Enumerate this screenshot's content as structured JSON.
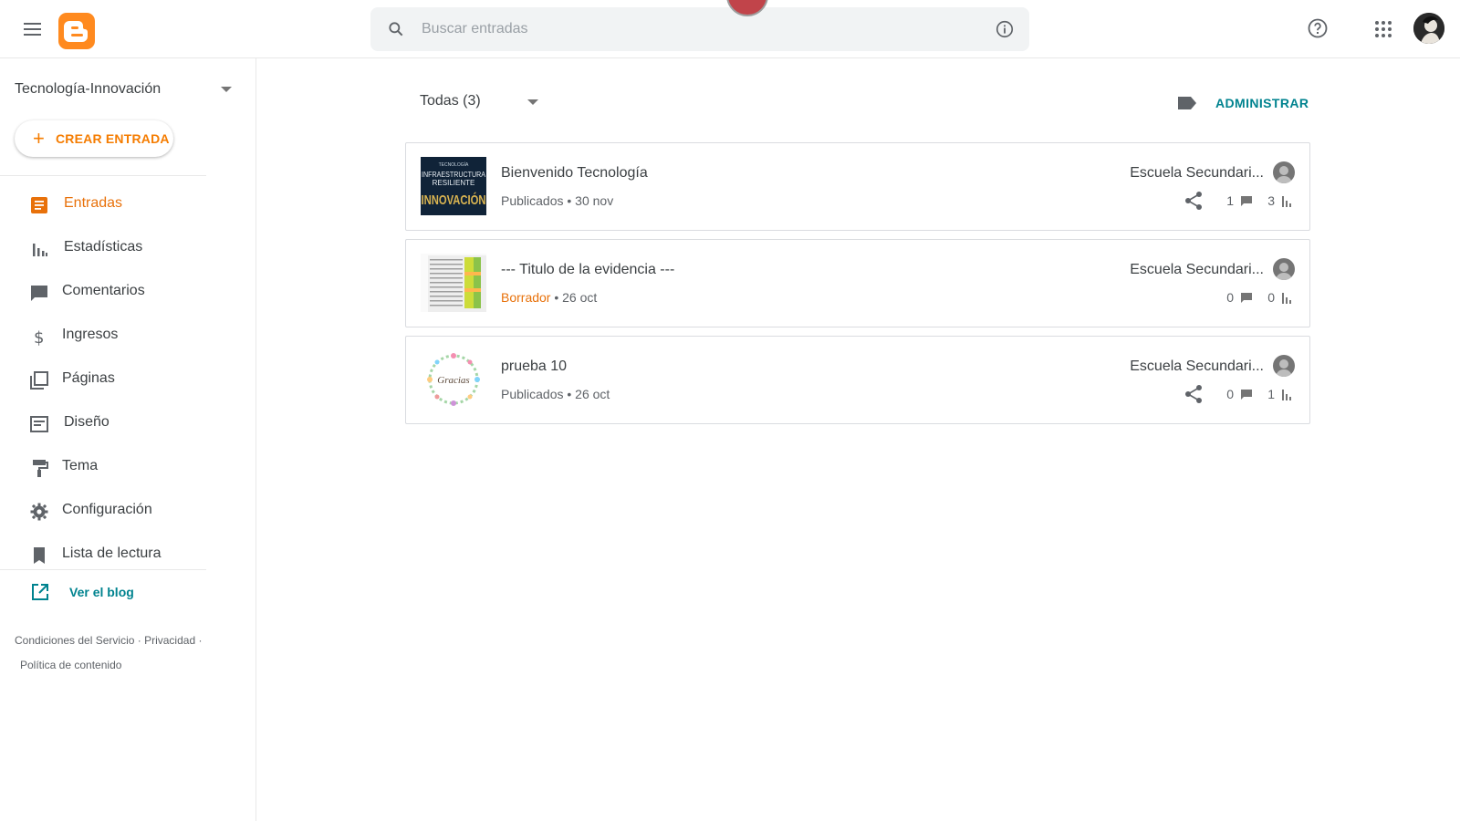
{
  "search": {
    "placeholder": "Buscar entradas"
  },
  "sidebar": {
    "blog_title": "Tecnología-Innovación",
    "create_label": "CREAR ENTRADA",
    "items": [
      {
        "label": "Entradas",
        "icon": "posts-icon"
      },
      {
        "label": "Estadísticas",
        "icon": "stats-icon"
      },
      {
        "label": "Comentarios",
        "icon": "comments-icon"
      },
      {
        "label": "Ingresos",
        "icon": "dollar-icon"
      },
      {
        "label": "Páginas",
        "icon": "pages-icon"
      },
      {
        "label": "Diseño",
        "icon": "layout-icon"
      },
      {
        "label": "Tema",
        "icon": "paint-roller-icon"
      },
      {
        "label": "Configuración",
        "icon": "gear-icon"
      },
      {
        "label": "Lista de lectura",
        "icon": "bookmark-icon"
      }
    ],
    "active": "Entradas",
    "view_blog": "Ver el blog",
    "footer": {
      "terms": "Condiciones del Servicio",
      "privacy": "Privacidad",
      "content_policy": "Política de contenido"
    }
  },
  "main": {
    "filter_label": "Todas (3)",
    "manage_label": "ADMINISTRAR",
    "posts": [
      {
        "title": "Bienvenido Tecnología",
        "status": "Publicados",
        "date": "• 30 nov",
        "author": "Escuela Secundari...",
        "comments": "1",
        "views": "3",
        "thumb_text": "INFRAESTRUCTURA RESILIENTE INNOVACIÓN",
        "shared": true
      },
      {
        "title": "--- Titulo de la evidencia ---",
        "status": "Borrador",
        "date": "• 26 oct",
        "author": "Escuela Secundari...",
        "comments": "0",
        "views": "0",
        "shared": false
      },
      {
        "title": "prueba 10",
        "status": "Publicados",
        "date": "• 26 oct",
        "author": "Escuela Secundari...",
        "comments": "0",
        "views": "1",
        "thumb_text": "Gracias",
        "shared": true
      }
    ]
  },
  "colors": {
    "accent": "#e8710a",
    "link": "#00838f",
    "brand": "#ff8a1f"
  }
}
